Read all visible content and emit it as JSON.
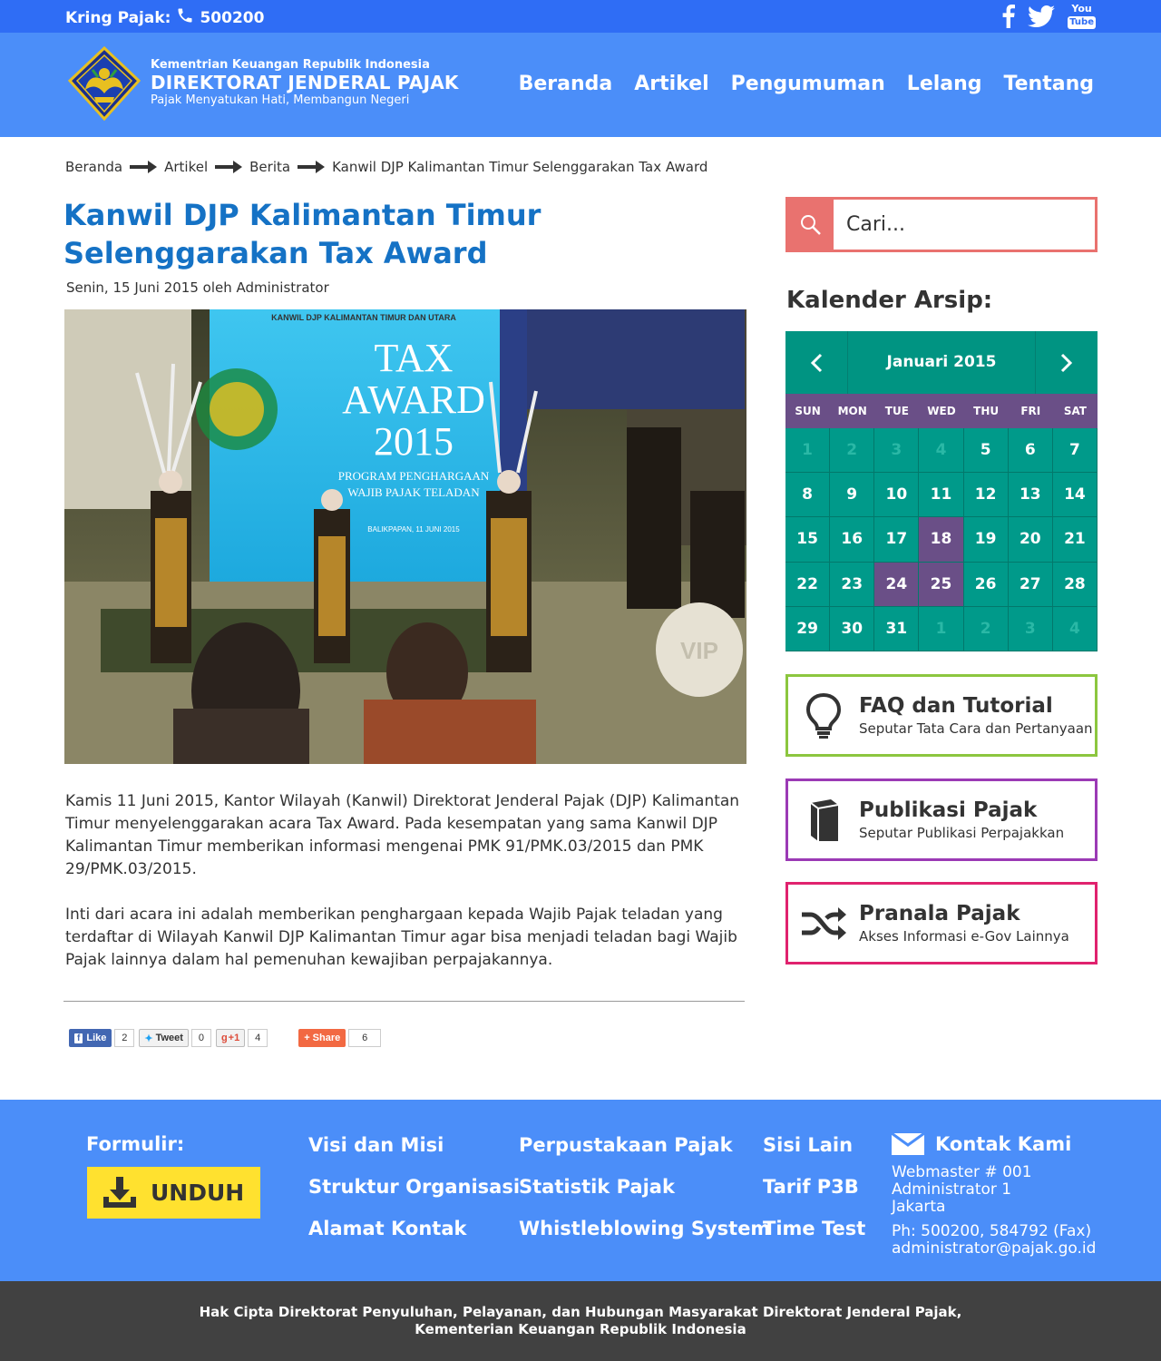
{
  "topbar": {
    "kring_label": "Kring Pajak:",
    "kring_number": "500200",
    "social": [
      "facebook-icon",
      "twitter-icon",
      "youtube-icon"
    ],
    "youtube_you": "You",
    "youtube_tube": "Tube"
  },
  "header": {
    "ministry": "Kementrian Keuangan Republik Indonesia",
    "agency": "DIREKTORAT JENDERAL PAJAK",
    "tagline": "Pajak Menyatukan Hati, Membangun Negeri",
    "nav": [
      "Beranda",
      "Artikel",
      "Pengumuman",
      "Lelang",
      "Tentang"
    ]
  },
  "breadcrumb": [
    "Beranda",
    "Artikel",
    "Berita",
    "Kanwil DJP Kalimantan Timur Selenggarakan Tax Award"
  ],
  "article": {
    "title": "Kanwil DJP Kalimantan Timur Selenggarakan Tax Award",
    "meta": "Senin, 15 Juni 2015 oleh Administrator",
    "photo": {
      "banner_header": "KANWIL DJP KALIMANTAN TIMUR DAN UTARA",
      "banner_tax": "TAX",
      "banner_award": "AWARD",
      "banner_year": "2015",
      "banner_program": "PROGRAM PENGHARGAAN",
      "banner_wp": "WAJIB PAJAK TELADAN",
      "banner_date": "BALIKPAPAN, 11 JUNI 2015",
      "vip": "VIP"
    },
    "paragraphs": [
      "Kamis 11 Juni 2015, Kantor Wilayah (Kanwil) Direktorat Jenderal Pajak (DJP) Kalimantan Timur menyelenggarakan acara Tax Award. Pada kesempatan yang sama Kanwil DJP Kalimantan Timur memberikan informasi mengenai PMK 91/PMK.03/2015 dan PMK 29/PMK.03/2015.",
      "Inti dari acara ini adalah memberikan penghargaan kepada Wajib Pajak teladan yang terdaftar di Wilayah Kanwil DJP Kalimantan Timur agar bisa menjadi teladan bagi Wajib Pajak lainnya dalam hal pemenuhan kewajiban perpajakannya."
    ]
  },
  "share": {
    "like_label": "Like",
    "like_count": "2",
    "tweet_label": "Tweet",
    "tweet_count": "0",
    "gplus_label": "+1",
    "gplus_count": "4",
    "share_label": "Share",
    "share_count": "6"
  },
  "search": {
    "placeholder": "Cari..."
  },
  "calendar": {
    "title": "Kalender Arsip:",
    "month": "Januari 2015",
    "dow": [
      "SUN",
      "MON",
      "TUE",
      "WED",
      "THU",
      "FRI",
      "SAT"
    ],
    "days": [
      "1",
      "2",
      "3",
      "4",
      "5",
      "6",
      "7",
      "8",
      "9",
      "10",
      "11",
      "12",
      "13",
      "14",
      "15",
      "16",
      "17",
      "18",
      "19",
      "20",
      "21",
      "22",
      "23",
      "24",
      "25",
      "26",
      "27",
      "28",
      "29",
      "30",
      "31",
      "1",
      "2",
      "3",
      "4"
    ],
    "muted_indexes": [
      0,
      1,
      2,
      3,
      31,
      32,
      33,
      34
    ],
    "highlight_indexes": [
      17,
      23,
      24
    ]
  },
  "boxes": [
    {
      "title": "FAQ dan Tutorial",
      "subtitle": "Seputar Tata Cara dan Pertanyaan",
      "color": "#8cc63f",
      "icon": "lightbulb-icon"
    },
    {
      "title": "Publikasi Pajak",
      "subtitle": "Seputar Publikasi Perpajakkan",
      "color": "#9b3ab5",
      "icon": "book-icon"
    },
    {
      "title": "Pranala Pajak",
      "subtitle": "Akses Informasi e-Gov Lainnya",
      "color": "#e0226e",
      "icon": "shuffle-icon"
    }
  ],
  "footer": {
    "formulir_label": "Formulir:",
    "unduh_label": "UNDUH",
    "col1": [
      "Visi dan Misi",
      "Struktur Organisasi",
      "Alamat Kontak"
    ],
    "col2": [
      "Perpustakaan Pajak",
      "Statistik Pajak",
      "Whistleblowing System"
    ],
    "col3": [
      "Sisi Lain",
      "Tarif P3B",
      "Time Test"
    ],
    "contact_title": "Kontak Kami",
    "contact_lines": [
      "Webmaster # 001",
      "Administrator 1",
      "Jakarta",
      "Ph: 500200, 584792 (Fax)",
      "administrator@pajak.go.id"
    ]
  },
  "copyright": {
    "line1": "Hak Cipta Direktorat Penyuluhan, Pelayanan, dan Hubungan Masyarakat Direktorat Jenderal Pajak,",
    "line2": "Kementerian Keuangan Republik Indonesia"
  },
  "colors": {
    "topbar": "#2f6df5",
    "header": "#4b8ef9",
    "title": "#1572c5",
    "search_accent": "#e9726f",
    "calendar_teal": "#009a8a",
    "calendar_purple": "#6a4f87",
    "unduh": "#ffe12f",
    "copyright_bg": "#414141"
  }
}
